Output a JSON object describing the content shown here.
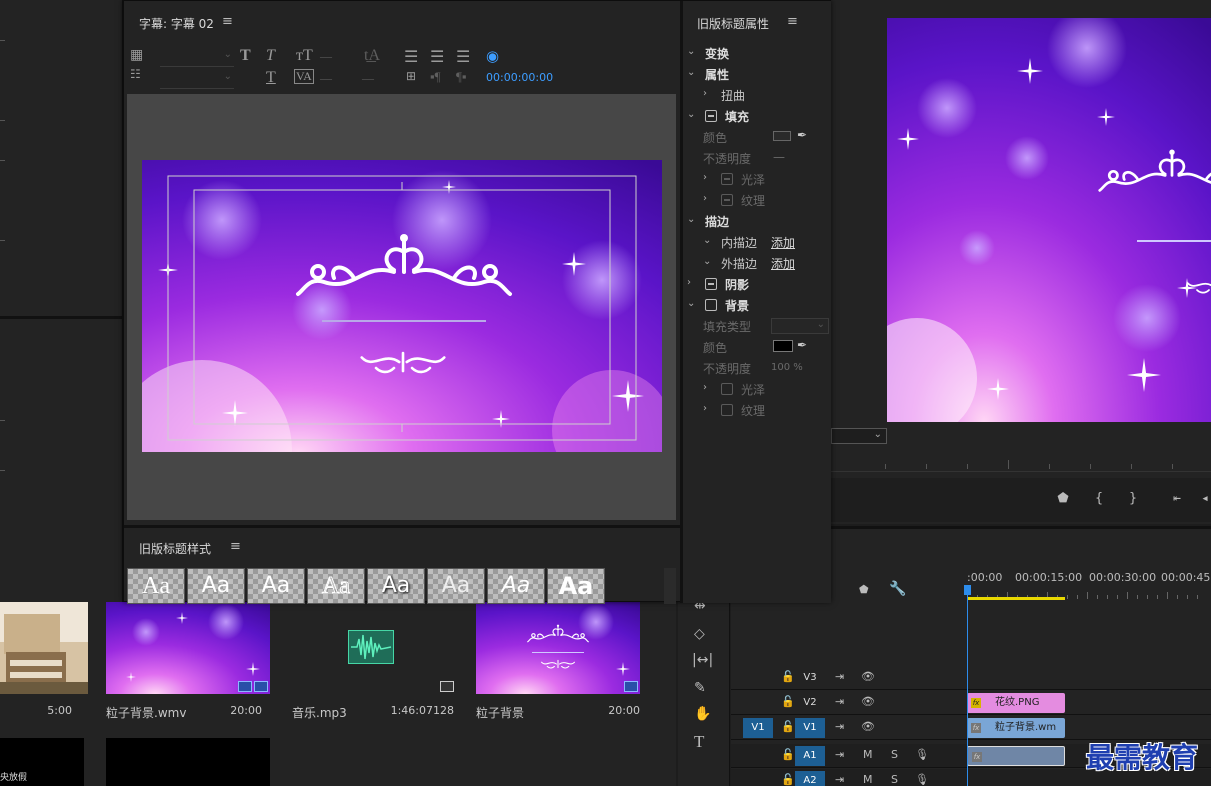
{
  "title_editor": {
    "tab_title": "字幕: 字幕 02",
    "timecode": "00:00:00:00",
    "styles_panel_title": "旧版标题样式",
    "style_swatches": [
      "Aa",
      "Aa",
      "Aa",
      "Aa",
      "Aa",
      "Aa",
      "Aa",
      "Aa"
    ]
  },
  "properties": {
    "panel_title": "旧版标题属性",
    "transform": "变换",
    "attributes": "属性",
    "distort": "扭曲",
    "fill": "填充",
    "color": "颜色",
    "opacity": "不透明度",
    "opacity_value": "—",
    "sheen": "光泽",
    "texture": "纹理",
    "stroke": "描边",
    "inner_stroke": "内描边",
    "outer_stroke": "外描边",
    "add": "添加",
    "shadow": "阴影",
    "background": "背景",
    "fill_type": "填充类型",
    "bg_color": "颜色",
    "bg_opacity": "不透明度",
    "bg_opacity_value": "100 %",
    "bg_sheen": "光泽",
    "bg_texture": "纹理",
    "bg_color_hex": "#000000"
  },
  "timeline": {
    "timecodes": [
      ":00:00",
      "00:00:15:00",
      "00:00:30:00",
      "00:00:45:"
    ],
    "tracks": [
      {
        "name": "V3",
        "type": "video"
      },
      {
        "name": "V2",
        "type": "video"
      },
      {
        "name": "V1",
        "type": "video",
        "source": "V1"
      },
      {
        "name": "A1",
        "type": "audio"
      },
      {
        "name": "A2",
        "type": "audio"
      }
    ],
    "clips": {
      "v2": "花纹.PNG",
      "v1": "粒子背景.wm"
    },
    "mute": "M",
    "solo": "S"
  },
  "project": {
    "items": [
      {
        "name": "",
        "duration": "5:00"
      },
      {
        "name": "粒子背景.wmv",
        "duration": "20:00"
      },
      {
        "name": "音乐.mp3",
        "duration": "1:46:07128"
      },
      {
        "name": "粒子背景",
        "duration": "20:00"
      }
    ],
    "bottom_left_caption": "央放假"
  },
  "watermark": "最需教育",
  "colors": {
    "accent_blue": "#2d8ceb",
    "track_target": "#1d5f94",
    "clip_pink": "#e48ce0",
    "clip_blue": "#7aa6d6",
    "clip_audio": "#6f86a6",
    "work_area": "#e8d800"
  }
}
